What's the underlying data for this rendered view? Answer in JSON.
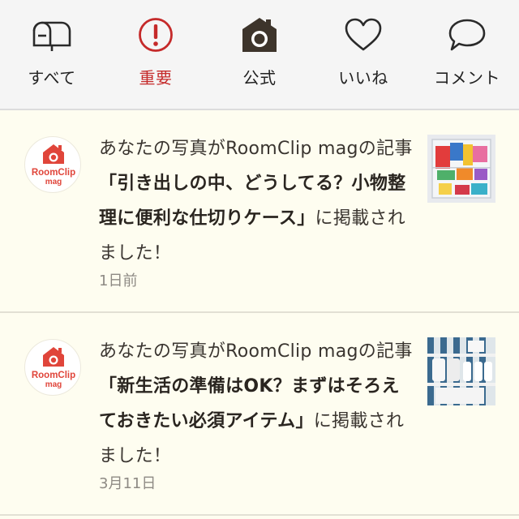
{
  "tabs": [
    {
      "label": "すべて",
      "icon": "mailbox-icon",
      "active": false
    },
    {
      "label": "重要",
      "icon": "alert-circle-icon",
      "active": true
    },
    {
      "label": "公式",
      "icon": "camera-house-icon",
      "active": false
    },
    {
      "label": "いいね",
      "icon": "heart-icon",
      "active": false
    },
    {
      "label": "コメント",
      "icon": "speech-bubble-icon",
      "active": false
    }
  ],
  "colors": {
    "accent": "#c52a2a",
    "brand_red": "#e0453a",
    "background": "#fefdf0",
    "tabbar": "#f5f5f5",
    "text": "#3a3530",
    "muted": "#8e8a84"
  },
  "brand": {
    "logo_line1": "RoomClip",
    "logo_line2": "mag"
  },
  "notifications": [
    {
      "prefix": "あなたの写真がRoomClip magの記事",
      "title": "「引き出しの中、どうしてる？小物整理に便利な仕切りケース」",
      "suffix": "に掲載されました！",
      "time": "1日前",
      "thumbnail": "drawer-organizer-photo"
    },
    {
      "prefix": "あなたの写真がRoomClip magの記事",
      "title": "「新生活の準備はOK？まずはそろえておきたい必須アイテム」",
      "suffix": "に掲載されました！",
      "time": "3月11日",
      "thumbnail": "towel-shelf-photo"
    }
  ]
}
